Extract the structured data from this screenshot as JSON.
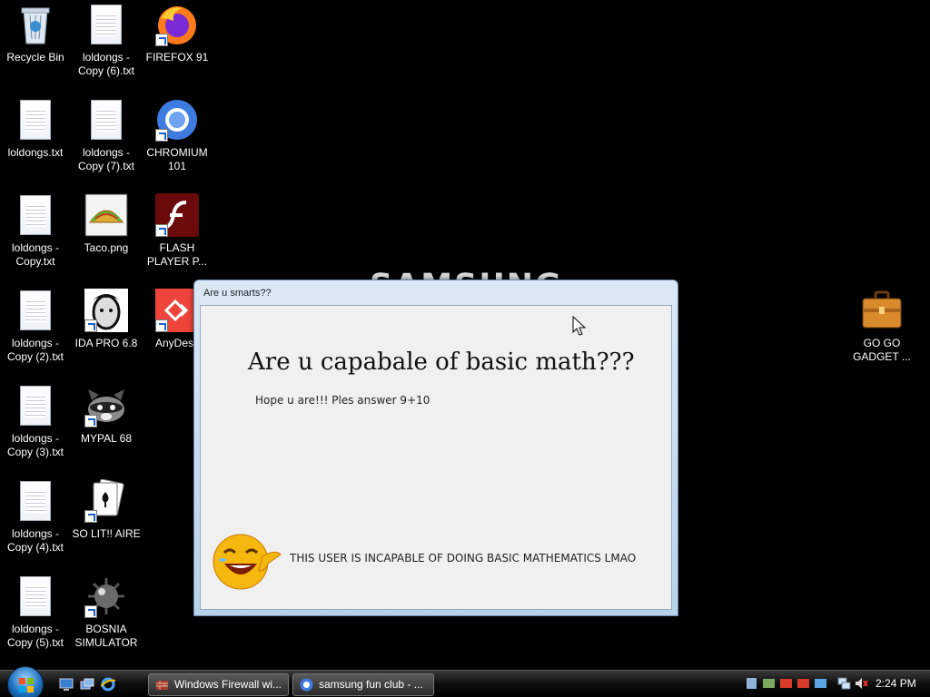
{
  "desktop": {
    "watermark": "SAMSUNG",
    "icons": [
      {
        "label": "Recycle Bin",
        "icon": "recycle-bin-icon"
      },
      {
        "label": "loldongs - Copy (6).txt",
        "icon": "text-file-icon"
      },
      {
        "label": "FIREFOX 91",
        "icon": "firefox-icon"
      },
      {
        "label": "loldongs.txt",
        "icon": "text-file-icon"
      },
      {
        "label": "loldongs - Copy (7).txt",
        "icon": "text-file-icon"
      },
      {
        "label": "CHROMIUM 101",
        "icon": "chromium-icon"
      },
      {
        "label": "loldongs - Copy.txt",
        "icon": "text-file-icon"
      },
      {
        "label": "Taco.png",
        "icon": "image-file-icon"
      },
      {
        "label": "FLASH PLAYER P...",
        "icon": "flash-player-icon"
      },
      {
        "label": "loldongs - Copy (2).txt",
        "icon": "text-file-icon"
      },
      {
        "label": "IDA PRO 6.8",
        "icon": "ida-pro-icon"
      },
      {
        "label": "AnyDesk",
        "icon": "anydesk-icon"
      },
      {
        "label": "loldongs - Copy (3).txt",
        "icon": "text-file-icon"
      },
      {
        "label": "MYPAL 68",
        "icon": "mypal-icon"
      },
      {
        "label": "loldongs - Copy (4).txt",
        "icon": "text-file-icon"
      },
      {
        "label": "SO LIT!! AIRE",
        "icon": "solitaire-icon"
      },
      {
        "label": "loldongs - Copy (5).txt",
        "icon": "text-file-icon"
      },
      {
        "label": "BOSNIA SIMULATOR",
        "icon": "minesweeper-icon"
      },
      {
        "label": "GO GO GADGET ...",
        "icon": "briefcase-icon"
      }
    ]
  },
  "dialog": {
    "title": "Are u smarts??",
    "heading": "Are u capabale of basic math???",
    "message": "Hope u are!!! Ples answer 9+10",
    "status": "THIS USER IS INCAPABLE OF DOING BASIC MATHEMATICS LMAO",
    "emoji": "laughing-emoji-icon"
  },
  "taskbar": {
    "start": "windows-start-orb",
    "quick_launch": [
      "show-desktop-icon",
      "switch-windows-icon",
      "internet-explorer-icon"
    ],
    "buttons": [
      {
        "label": "Windows Firewall wi...",
        "icon": "firewall-icon"
      },
      {
        "label": "samsung fun club - ...",
        "icon": "chromium-icon"
      }
    ],
    "tray_icons": [
      "tray-icon-1",
      "tray-icon-2",
      "tray-icon-3",
      "tray-icon-4",
      "tray-icon-5",
      "network-icon",
      "volume-muted-icon"
    ],
    "clock": "2:24 PM"
  },
  "colors": {
    "desktop_bg": "#000000",
    "dialog_frame": "#c4d8ee",
    "dialog_body": "#f0f0f0",
    "taskbar": "#1a1a1a"
  }
}
